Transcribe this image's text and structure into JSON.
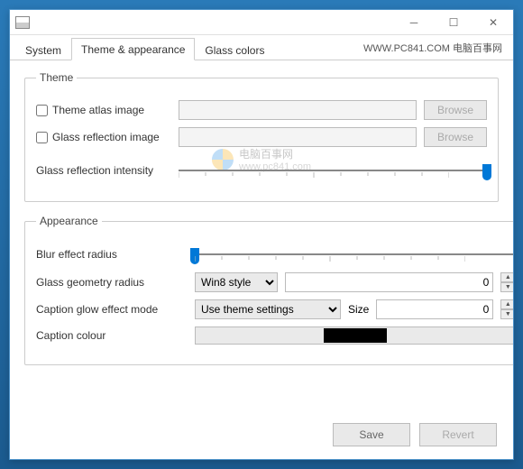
{
  "window": {
    "title": ""
  },
  "tabs": {
    "system": "System",
    "theme": "Theme & appearance",
    "glass": "Glass colors"
  },
  "watermark_tab": "WWW.PC841.COM 电脑百事网",
  "watermark_center": {
    "line1": "电脑百事网",
    "line2": "www.pc841.com"
  },
  "theme": {
    "legend": "Theme",
    "atlas_label": "Theme atlas image",
    "atlas_value": "",
    "reflection_label": "Glass reflection image",
    "reflection_value": "",
    "intensity_label": "Glass reflection intensity",
    "intensity_value": 100,
    "browse": "Browse"
  },
  "appearance": {
    "legend": "Appearance",
    "blur_label": "Blur effect radius",
    "blur_value": 0,
    "geometry_label": "Glass geometry radius",
    "geometry_option": "Win8 style",
    "geometry_value": "0",
    "caption_mode_label": "Caption glow effect mode",
    "caption_mode_option": "Use theme settings",
    "size_label": "Size",
    "size_value": "0",
    "caption_colour_label": "Caption colour",
    "caption_colour": "#000000"
  },
  "footer": {
    "save": "Save",
    "revert": "Revert"
  }
}
